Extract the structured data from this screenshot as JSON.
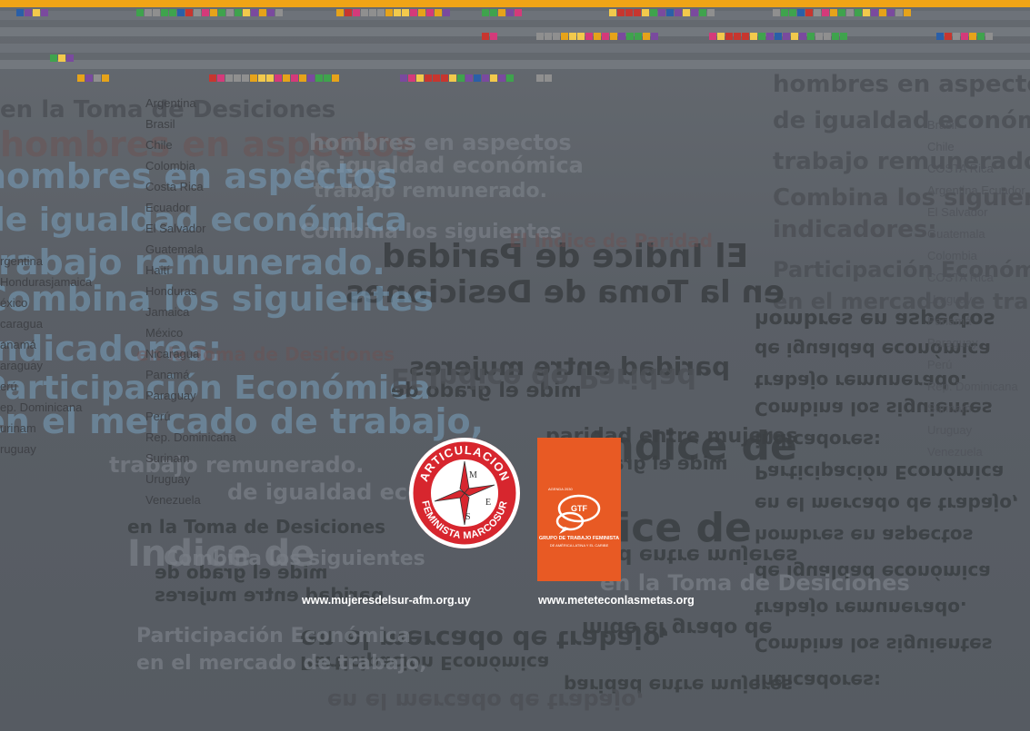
{
  "colors": {
    "top_band": "#f0a416",
    "afm_red": "#d7262e",
    "gtf_orange": "#e85a24"
  },
  "background_phrases": [
    "en la Toma de Desiciones",
    "hombres en aspectos",
    "de igualdad económica",
    "trabajo remunerado.",
    "Combina los siguientes",
    "indicadores:",
    "Participación Económica",
    "en el mercado de trabajo,",
    "El Indice de Paridad",
    "en la Toma de Desiciones",
    "paridad entre mujeres",
    "mide el grado de",
    "Indice de"
  ],
  "countries_left": [
    "Argentina",
    "Brasil",
    "Chile",
    "Colombia",
    "Costa Rica",
    "Ecuador",
    "El Salvador",
    "Guatemala",
    "Haití",
    "Honduras",
    "Jamaica",
    "México",
    "Nicaragua",
    "Panamá",
    "Paraguay",
    "Perú",
    "Rep. Dominicana",
    "Surinam",
    "Uruguay",
    "Venezuela"
  ],
  "countries_far_left": [
    "rgentina",
    "Hondurasjamaica",
    "éxico",
    "caragua",
    "anamá",
    "araguay",
    "erú",
    "ep. Dominicana",
    "urinam",
    "ruguay"
  ],
  "countries_right": [
    "Brasil",
    "Chile",
    "COSTA Rica",
    "Argentina Ecuador",
    "El Salvador",
    "Guatemala",
    "Colombia",
    "COSTA Rica",
    "Uruguay",
    "Panamá",
    "Paraguay",
    "Perú",
    "Rep. Dominicana",
    "Surinam",
    "Uruguay",
    "Venezuela"
  ],
  "logos": {
    "afm": {
      "name": "Articulación Feminista Marcosur",
      "top_text": "ARTICULACION",
      "bottom_text": "FEMINISTA MARCOSUR",
      "letters": [
        "M",
        "E",
        "S"
      ]
    },
    "gtf": {
      "small_top": "AGENDA 2030",
      "acronym": "GTF",
      "title": "GRUPO DE TRABAJO FEMINISTA",
      "subtitle": "DE AMÉRICA LATINA Y EL CARIBE"
    }
  },
  "links": {
    "afm_url": "www.mujeresdelsur-afm.org.uy",
    "gtf_url": "www.meteteconlasmetas.org"
  }
}
